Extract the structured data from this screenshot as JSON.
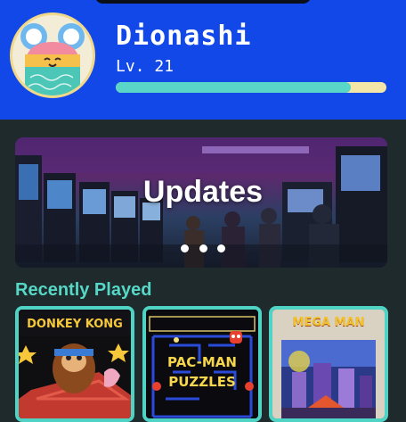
{
  "profile": {
    "username": "Dionashi",
    "level_label": "Lv. 21",
    "xp_progress": 0.87
  },
  "updates": {
    "title": "Updates"
  },
  "recently_played": {
    "title": "Recently Played",
    "games": [
      {
        "box_text": "DONKEY KONG"
      },
      {
        "box_text_top": "PAC-MAN",
        "box_text_bottom": "PUZZLES"
      },
      {
        "box_text": "MEGA MAN"
      }
    ]
  },
  "colors": {
    "header_bg": "#1247e8",
    "page_bg": "#1f2a2c",
    "accent_teal": "#56d8c7",
    "xp_track": "#f4e6a6"
  }
}
